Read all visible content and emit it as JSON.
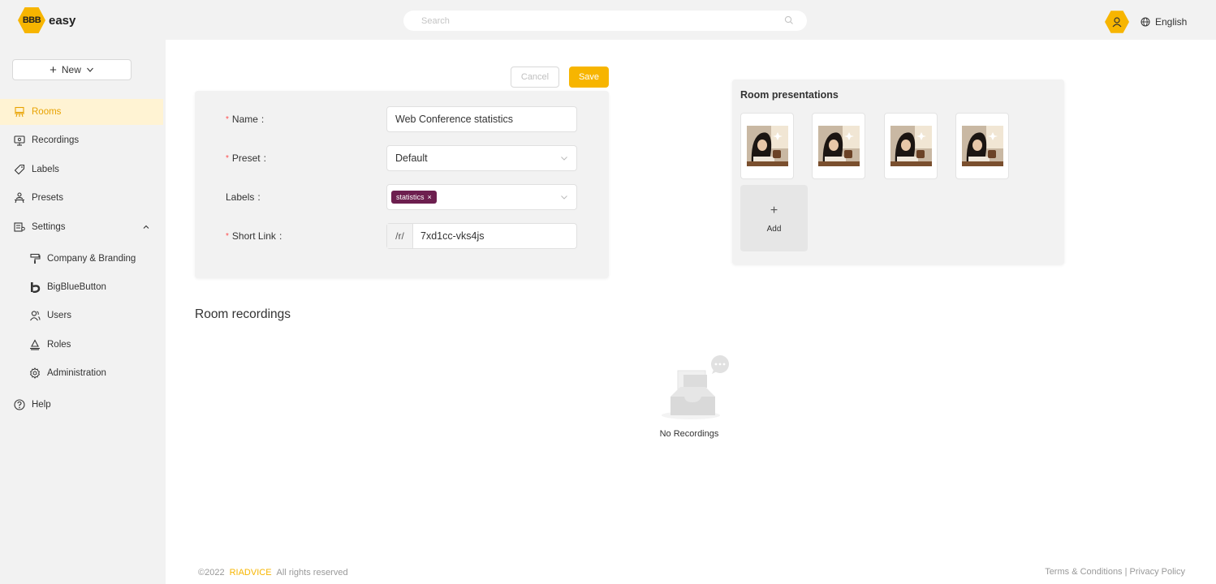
{
  "header": {
    "logo_mark": "BBB",
    "logo_text": "easy",
    "search_placeholder": "Search",
    "language": "English"
  },
  "sidebar": {
    "new_label": "New",
    "items": [
      {
        "label": "Rooms",
        "icon": "rooms-icon",
        "active": true
      },
      {
        "label": "Recordings",
        "icon": "recordings-icon"
      },
      {
        "label": "Labels",
        "icon": "tag-icon"
      },
      {
        "label": "Presets",
        "icon": "presets-icon"
      },
      {
        "label": "Settings",
        "icon": "settings-icon",
        "expanded": true
      },
      {
        "label": "Company & Branding",
        "icon": "paint-roller-icon"
      },
      {
        "label": "BigBlueButton",
        "icon": "bigbluebutton-icon"
      },
      {
        "label": "Users",
        "icon": "users-icon"
      },
      {
        "label": "Roles",
        "icon": "roles-icon"
      },
      {
        "label": "Administration",
        "icon": "gear-icon"
      },
      {
        "label": "Help",
        "icon": "help-icon"
      }
    ]
  },
  "form": {
    "cancel_label": "Cancel",
    "save_label": "Save",
    "name_label": "Name",
    "name_value": "Web Conference statistics",
    "preset_label": "Preset",
    "preset_value": "Default",
    "labels_label": "Labels",
    "labels_tag": "statistics",
    "short_link_label": "Short Link",
    "short_link_prefix": "/r/",
    "short_link_value": "7xd1cc-vks4js"
  },
  "presentations": {
    "title": "Room presentations",
    "add_label": "Add",
    "count": 4
  },
  "recordings": {
    "title": "Room recordings",
    "empty_text": "No Recordings"
  },
  "footer": {
    "copyright": "©2022",
    "brand": "RIADVICE",
    "rights": "All rights reserved",
    "links": "Terms & Conditions | Privacy Policy"
  },
  "colors": {
    "accent": "#f7b500",
    "tag": "#6d1f4f",
    "active_bg": "#fff3d3"
  }
}
